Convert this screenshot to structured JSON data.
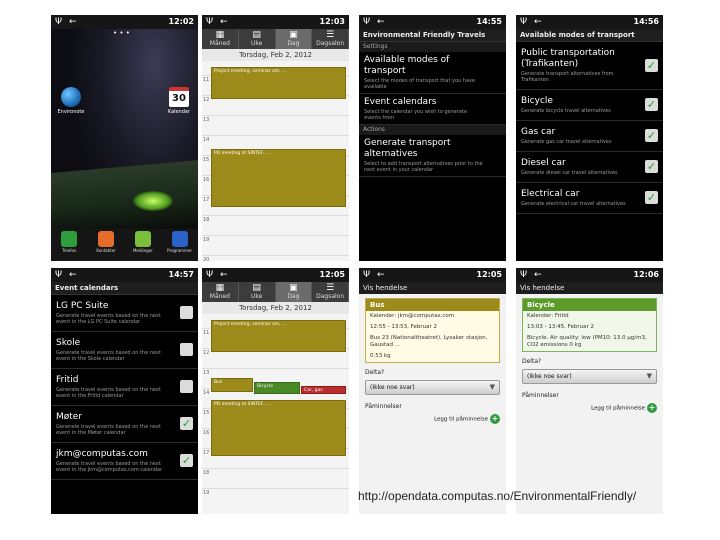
{
  "caption": "http://opendata.computas.no/EnvironmentalFriendly/",
  "status_icons": "Ψ ←",
  "p1": {
    "time": "12:02",
    "apps": [
      {
        "label": "Environote"
      },
      {
        "label": "Kalender",
        "badge": "30"
      }
    ],
    "dock": [
      "Telefon",
      "Kontakter",
      "Meldinger",
      "Programmer"
    ]
  },
  "p2": {
    "time": "12:03",
    "tabs": [
      "Måned",
      "Uke",
      "Dag",
      "Dagsalon"
    ],
    "date": "Torsdag, Feb 2, 2012",
    "hours": [
      "11",
      "12",
      "13",
      "14",
      "15",
      "16",
      "17",
      "18",
      "19",
      "20"
    ],
    "events": [
      "Project meeting, seminar om, ...",
      "PD meeting at SINTEF, ..."
    ]
  },
  "p3": {
    "time": "14:55",
    "title": "Environmental Friendly Travels",
    "sec_settings": "Settings",
    "items": [
      {
        "title": "Available modes of transport",
        "sub": "Select the modes of transport that you have available"
      },
      {
        "title": "Event calendars",
        "sub": "Select the calendar you wish to generate events from"
      }
    ],
    "sec_actions": "Actions",
    "action": {
      "title": "Generate transport alternatives",
      "sub": "Select to add transport alternatives prior to the next event in your calendar"
    }
  },
  "p4": {
    "time": "14:56",
    "title": "Available modes of transport",
    "items": [
      {
        "title": "Public transportation (Trafikanten)",
        "sub": "Generate transport alternatives from Trafikanten"
      },
      {
        "title": "Bicycle",
        "sub": "Generate bicycle travel alternatives"
      },
      {
        "title": "Gas car",
        "sub": "Generate gas car travel alternatives"
      },
      {
        "title": "Diesel car",
        "sub": "Generate diesel car travel alternatives"
      },
      {
        "title": "Electrical car",
        "sub": "Generate electrical car travel alternatives"
      }
    ]
  },
  "p5": {
    "time": "14:57",
    "title": "Event calendars",
    "items": [
      {
        "title": "LG PC Suite",
        "sub": "Generate travel events based on the next event in the LG PC Suite calendar"
      },
      {
        "title": "Skole",
        "sub": "Generate travel events based on the next event in the Skole calendar"
      },
      {
        "title": "Fritid",
        "sub": "Generate travel events based on the next event in the Fritid calendar"
      },
      {
        "title": "Møter",
        "sub": "Generate travel events based on the next event in the Møter calendar"
      },
      {
        "title": "jkm@computas.com",
        "sub": "Generate travel events based on the next event in the jkm@computas.com calendar"
      }
    ]
  },
  "p6": {
    "time": "12:05",
    "tabs": [
      "Måned",
      "Uke",
      "Dag",
      "Dagsalon"
    ],
    "date": "Torsdag, Feb 2, 2012",
    "hours": [
      "11",
      "12",
      "13",
      "14",
      "15",
      "16",
      "17",
      "18",
      "19",
      "20"
    ],
    "events": [
      "Project meeting, seminar om, ...",
      "Bus",
      "Bicycle",
      "Car, gas",
      "PD meeting at SINTEF, ..."
    ]
  },
  "p7": {
    "time": "12:05",
    "title": "Vis hendelse",
    "card": {
      "name": "Bus",
      "cal": "Kalender: jkm@computas.com",
      "time": "12:55 - 13:53, Februar 2",
      "desc": "Bus 23 (Nationaltheatret), Lysaker stasjon, Gaustad ...",
      "co2": "0.53 kg"
    },
    "delta_label": "Delta?",
    "delta_value": "(Ikke noe svar)",
    "rem_label": "Påminnelser",
    "add": "Legg til påminnelse"
  },
  "p8": {
    "time": "12:06",
    "title": "Vis hendelse",
    "card": {
      "name": "Bicycle",
      "cal": "Kalender: Fritid",
      "time": "13:03 - 13:45, Februar 2",
      "desc": "Bicycle. Air quality: low (PM10: 13.0 µg/m3, CO2 emissions 0 kg"
    },
    "delta_label": "Delta?",
    "delta_value": "(Ikke noe svar)",
    "rem_label": "Påminnelser",
    "add": "Legg til påminnelse"
  }
}
